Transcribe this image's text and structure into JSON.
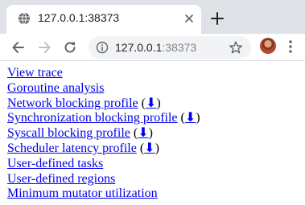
{
  "browser": {
    "tab": {
      "title": "127.0.0.1:38373",
      "favicon": "globe-icon"
    },
    "toolbar": {
      "back_icon": "back-arrow-icon",
      "forward_icon": "forward-arrow-icon",
      "reload_icon": "reload-icon",
      "url_host": "127.0.0.1",
      "url_port": ":38373",
      "star_icon": "bookmark-star-icon",
      "menu_icon": "three-dots-menu-icon"
    },
    "colors": {
      "tabstrip": "#dee1e6",
      "omnibox": "#f1f3f4",
      "link": "#0000ee"
    }
  },
  "page": {
    "links": [
      {
        "label": "View trace"
      },
      {
        "label": "Goroutine analysis"
      },
      {
        "label": "Network blocking profile",
        "download": "⬇"
      },
      {
        "label": "Synchronization blocking profile",
        "download": "⬇"
      },
      {
        "label": "Syscall blocking profile",
        "download": "⬇"
      },
      {
        "label": "Scheduler latency profile",
        "download": "⬇"
      },
      {
        "label": "User-defined tasks"
      },
      {
        "label": "User-defined regions"
      },
      {
        "label": "Minimum mutator utilization"
      }
    ]
  }
}
